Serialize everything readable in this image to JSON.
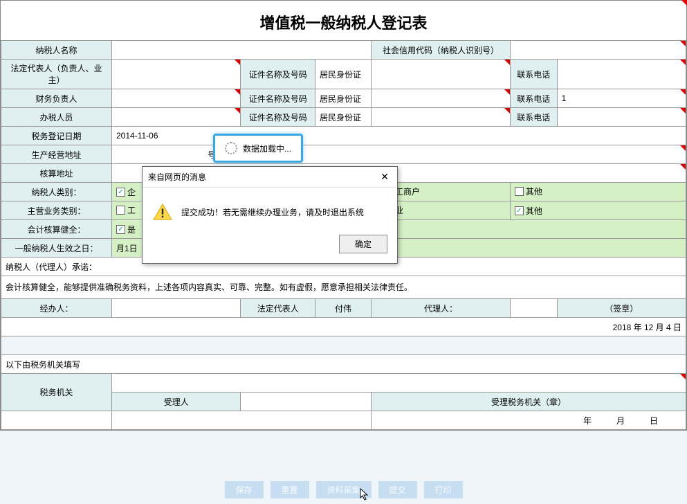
{
  "title": "增值税一般纳税人登记表",
  "row1": {
    "l1": "纳税人名称",
    "v1": "",
    "l2": "社会信用代码（纳税人识别号）",
    "v2": ""
  },
  "row2": {
    "l1": "法定代表人（负责人、业主）",
    "v1": "",
    "l2": "证件名称及号码",
    "v2": "居民身份证",
    "v3": "",
    "l3": "联系电话",
    "v4": ""
  },
  "row3": {
    "l1": "财务负责人",
    "v1": "",
    "l2": "证件名称及号码",
    "v2": "居民身份证",
    "v3": "",
    "l3": "联系电话",
    "v4": "1"
  },
  "row4": {
    "l1": "办税人员",
    "v1": "",
    "l2": "证件名称及号码",
    "v2": "居民身份证",
    "v3": "",
    "l3": "联系电话",
    "v4": ""
  },
  "row5": {
    "l1": "税务登记日期",
    "v1": "2014-11-06"
  },
  "row6": {
    "l1": "生产经营地址",
    "v1": "",
    "suffix": "号"
  },
  "row7": {
    "l1": "核算地址",
    "v1": ""
  },
  "row8": {
    "l1": "纳税人类别：",
    "c1": "企",
    "c2": "体工商户",
    "c3": "其他"
  },
  "row9": {
    "l1": "主营业务类别：",
    "c1": "工",
    "c2": "务业",
    "c3": "其他"
  },
  "row10": {
    "l1": "会计核算健全：",
    "c1": "是"
  },
  "row11": {
    "l1": "一般纳税人生效之日：",
    "v1": "月1日"
  },
  "promise_label": "纳税人（代理人）承诺：",
  "promise_text": "会计核算健全，能够提供准确税务资料，上述各项内容真实、可靠、完整。如有虚假，愿意承担相关法律责任。",
  "sig": {
    "l1": "经办人：",
    "l2": "法定代表人",
    "v2": "付伟",
    "l3": "代理人：",
    "l4": "（签章）"
  },
  "date_line": "2018 年 12 月 4 日",
  "below_label": "以下由税务机关填写",
  "tax_org": {
    "l1": "税务机关",
    "l2": "受理人",
    "l3": "受理税务机关（章）",
    "date": "年　　　月　　　日"
  },
  "loading": "数据加载中...",
  "modal": {
    "title": "来自网页的消息",
    "msg": "提交成功！若无需继续办理业务，请及时退出系统",
    "ok": "确定"
  },
  "footer": {
    "b1": "保存",
    "b2": "重置",
    "b3": "资料采集",
    "b4": "提交",
    "b5": "打印"
  }
}
